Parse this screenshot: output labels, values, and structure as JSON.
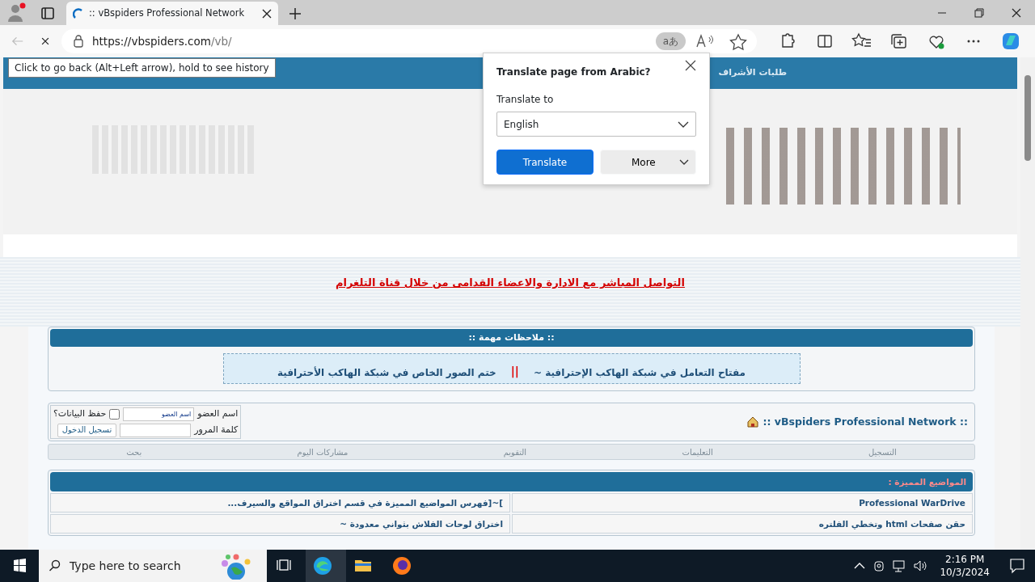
{
  "browser": {
    "tab_title": ":: vBspiders Professional Network",
    "url_host": "https://vbspiders.com",
    "url_path": "/vb/",
    "back_tooltip": "Click to go back (Alt+Left arrow), hold to see history",
    "translate_badge": "aあ"
  },
  "translate_popup": {
    "title": "Translate page from Arabic?",
    "label": "Translate to",
    "language": "English",
    "translate_button": "Translate",
    "more_button": "More"
  },
  "site_nav": {
    "items": [
      {
        "label": "طلبات الأشراف"
      }
    ]
  },
  "telegram_link": "التواصل المباشر مع الادارة والاعضاء القدامى من خلال قناة التلغرام",
  "notes": {
    "title": ":: ملاحظات مهمة ::",
    "links": [
      "مفتاح التعامل في شبكة الهاكب الإحترافية ~",
      "ختم الصور الخاص في شبكة الهاكب الأحترافية"
    ],
    "separator": "||"
  },
  "login": {
    "site_title": ":: vBspiders Professional Network ::",
    "username_label": "اسم العضو",
    "username_value": "اسم العضو",
    "password_label": "كلمة المرور",
    "remember_label": "حفظ البيانات؟",
    "remember": false,
    "login_button": "تسجيل الدخول"
  },
  "forum_nav": [
    "التسجيل",
    "التعليمات",
    "التقويم",
    "مشاركات اليوم",
    "بحث"
  ],
  "featured": {
    "title": "المواضيع المميزة :",
    "rows": [
      [
        "Professional WarDrive",
        "]~[فهرس المواضيع المميزة في قسم اختراق المواقع والسيرف..."
      ],
      [
        "حقن صفحات html وتخطي الفلتره",
        "اختراق لوحات الفلاش بثواني معدودة ~"
      ]
    ]
  },
  "taskbar": {
    "search_placeholder": "Type here to search",
    "time": "2:16 PM",
    "date": "10/3/2024"
  }
}
